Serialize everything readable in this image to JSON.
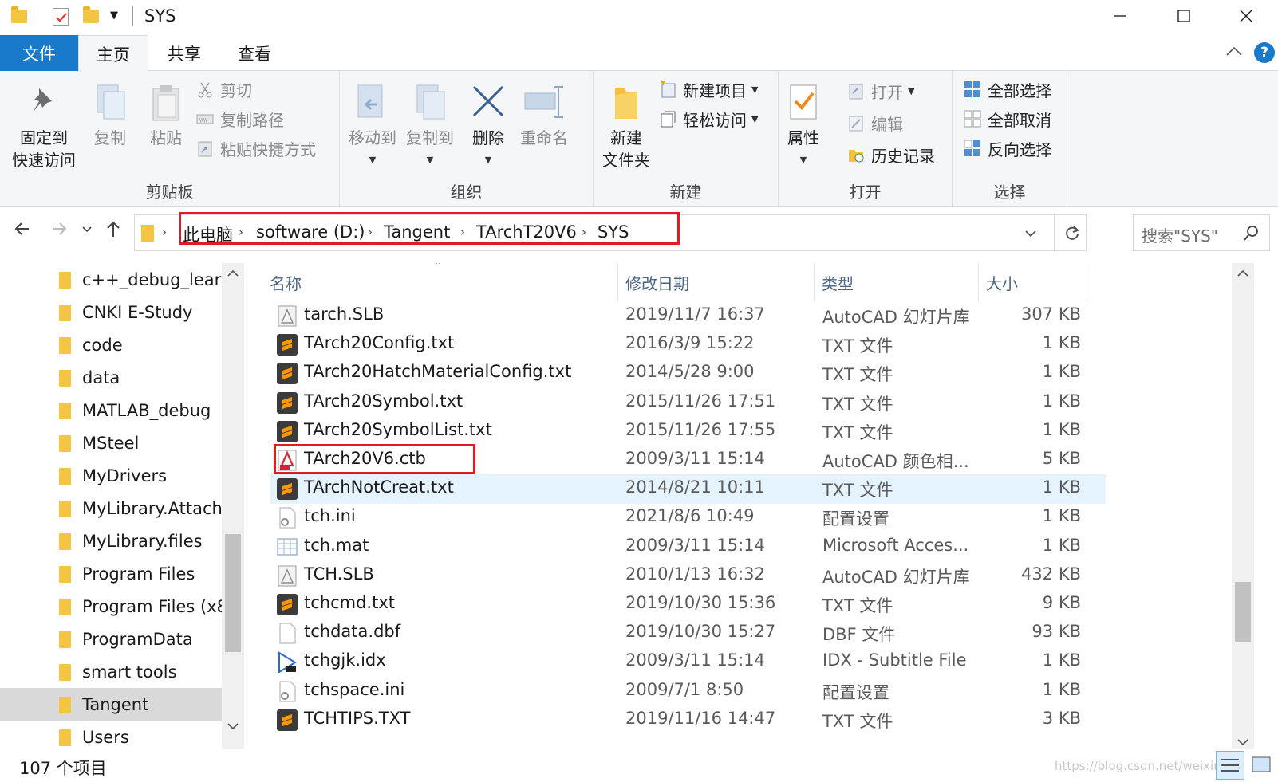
{
  "window": {
    "title": "SYS"
  },
  "tabs": [
    {
      "label": "文件"
    },
    {
      "label": "主页"
    },
    {
      "label": "共享"
    },
    {
      "label": "查看"
    }
  ],
  "ribbon": {
    "clipboard": {
      "pin": "固定到",
      "pin2": "快速访问",
      "copy": "复制",
      "paste": "粘贴",
      "cut": "剪切",
      "copy_path": "复制路径",
      "paste_shortcut": "粘贴快捷方式",
      "label": "剪贴板"
    },
    "organize": {
      "move_to": "移动到",
      "copy_to": "复制到",
      "delete": "删除",
      "rename": "重命名",
      "label": "组织"
    },
    "new": {
      "new_folder_1": "新建",
      "new_folder_2": "文件夹",
      "new_item": "新建项目",
      "easy_access": "轻松访问",
      "label": "新建"
    },
    "open": {
      "properties": "属性",
      "open": "打开",
      "edit": "编辑",
      "history": "历史记录",
      "label": "打开"
    },
    "select": {
      "select_all": "全部选择",
      "select_none": "全部取消",
      "invert": "反向选择",
      "label": "选择"
    }
  },
  "address": {
    "crumbs": [
      "此电脑",
      "software (D:)",
      "Tangent",
      "TArchT20V6",
      "SYS"
    ],
    "search_placeholder": "搜索\"SYS\""
  },
  "tree": [
    {
      "label": "c++_debug_learn"
    },
    {
      "label": "CNKI E-Study"
    },
    {
      "label": "code"
    },
    {
      "label": "data"
    },
    {
      "label": "MATLAB_debug"
    },
    {
      "label": "MSteel"
    },
    {
      "label": "MyDrivers"
    },
    {
      "label": "MyLibrary.Attach"
    },
    {
      "label": "MyLibrary.files"
    },
    {
      "label": "Program Files"
    },
    {
      "label": "Program Files (x8"
    },
    {
      "label": "ProgramData"
    },
    {
      "label": "smart tools"
    },
    {
      "label": "Tangent",
      "selected": true
    },
    {
      "label": "Users"
    }
  ],
  "columns": {
    "name": "名称",
    "date": "修改日期",
    "type": "类型",
    "size": "大小"
  },
  "files": [
    {
      "name": "tarch.SLB",
      "date": "2019/11/7 16:37",
      "type": "AutoCAD 幻灯片库",
      "size": "307 KB",
      "icon": "slb-icon"
    },
    {
      "name": "TArch20Config.txt",
      "date": "2016/3/9 15:22",
      "type": "TXT 文件",
      "size": "1 KB",
      "icon": "sublime-txt-icon"
    },
    {
      "name": "TArch20HatchMaterialConfig.txt",
      "date": "2014/5/28 9:00",
      "type": "TXT 文件",
      "size": "1 KB",
      "icon": "sublime-txt-icon"
    },
    {
      "name": "TArch20Symbol.txt",
      "date": "2015/11/26 17:51",
      "type": "TXT 文件",
      "size": "1 KB",
      "icon": "sublime-txt-icon"
    },
    {
      "name": "TArch20SymbolList.txt",
      "date": "2015/11/26 17:55",
      "type": "TXT 文件",
      "size": "1 KB",
      "icon": "sublime-txt-icon"
    },
    {
      "name": "TArch20V6.ctb",
      "date": "2009/3/11 15:14",
      "type": "AutoCAD 颜色相...",
      "size": "5 KB",
      "icon": "ctb-icon",
      "boxed": true
    },
    {
      "name": "TArchNotCreat.txt",
      "date": "2014/8/21 10:11",
      "type": "TXT 文件",
      "size": "1 KB",
      "icon": "sublime-txt-icon",
      "hover": true
    },
    {
      "name": "tch.ini",
      "date": "2021/8/6 10:49",
      "type": "配置设置",
      "size": "1 KB",
      "icon": "ini-icon"
    },
    {
      "name": "tch.mat",
      "date": "2009/3/11 15:14",
      "type": "Microsoft Acces...",
      "size": "1 KB",
      "icon": "mat-icon"
    },
    {
      "name": "TCH.SLB",
      "date": "2010/1/13 16:32",
      "type": "AutoCAD 幻灯片库",
      "size": "432 KB",
      "icon": "slb-icon"
    },
    {
      "name": "tchcmd.txt",
      "date": "2019/10/30 15:36",
      "type": "TXT 文件",
      "size": "9 KB",
      "icon": "sublime-txt-icon"
    },
    {
      "name": "tchdata.dbf",
      "date": "2019/10/30 15:27",
      "type": "DBF 文件",
      "size": "93 KB",
      "icon": "dbf-icon"
    },
    {
      "name": "tchgjk.idx",
      "date": "2009/3/11 15:14",
      "type": "IDX - Subtitle File",
      "size": "1 KB",
      "icon": "idx-icon"
    },
    {
      "name": "tchspace.ini",
      "date": "2009/7/1 8:50",
      "type": "配置设置",
      "size": "1 KB",
      "icon": "ini-icon"
    },
    {
      "name": "TCHTIPS.TXT",
      "date": "2019/11/16 14:47",
      "type": "TXT 文件",
      "size": "3 KB",
      "icon": "sublime-txt-icon"
    }
  ],
  "status": {
    "count": "107 个项目"
  },
  "watermark": "https://blog.csdn.net/weixin_..."
}
